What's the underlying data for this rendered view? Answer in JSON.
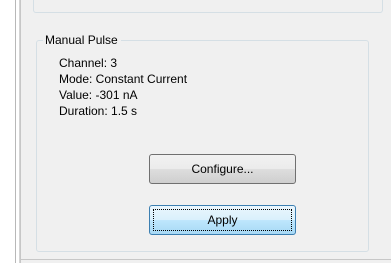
{
  "group": {
    "title": "Manual Pulse",
    "channel": "Channel: 3",
    "mode": "Mode: Constant Current",
    "value": "Value: -301 nA",
    "duration": "Duration: 1.5 s"
  },
  "buttons": {
    "configure": "Configure...",
    "apply": "Apply"
  }
}
